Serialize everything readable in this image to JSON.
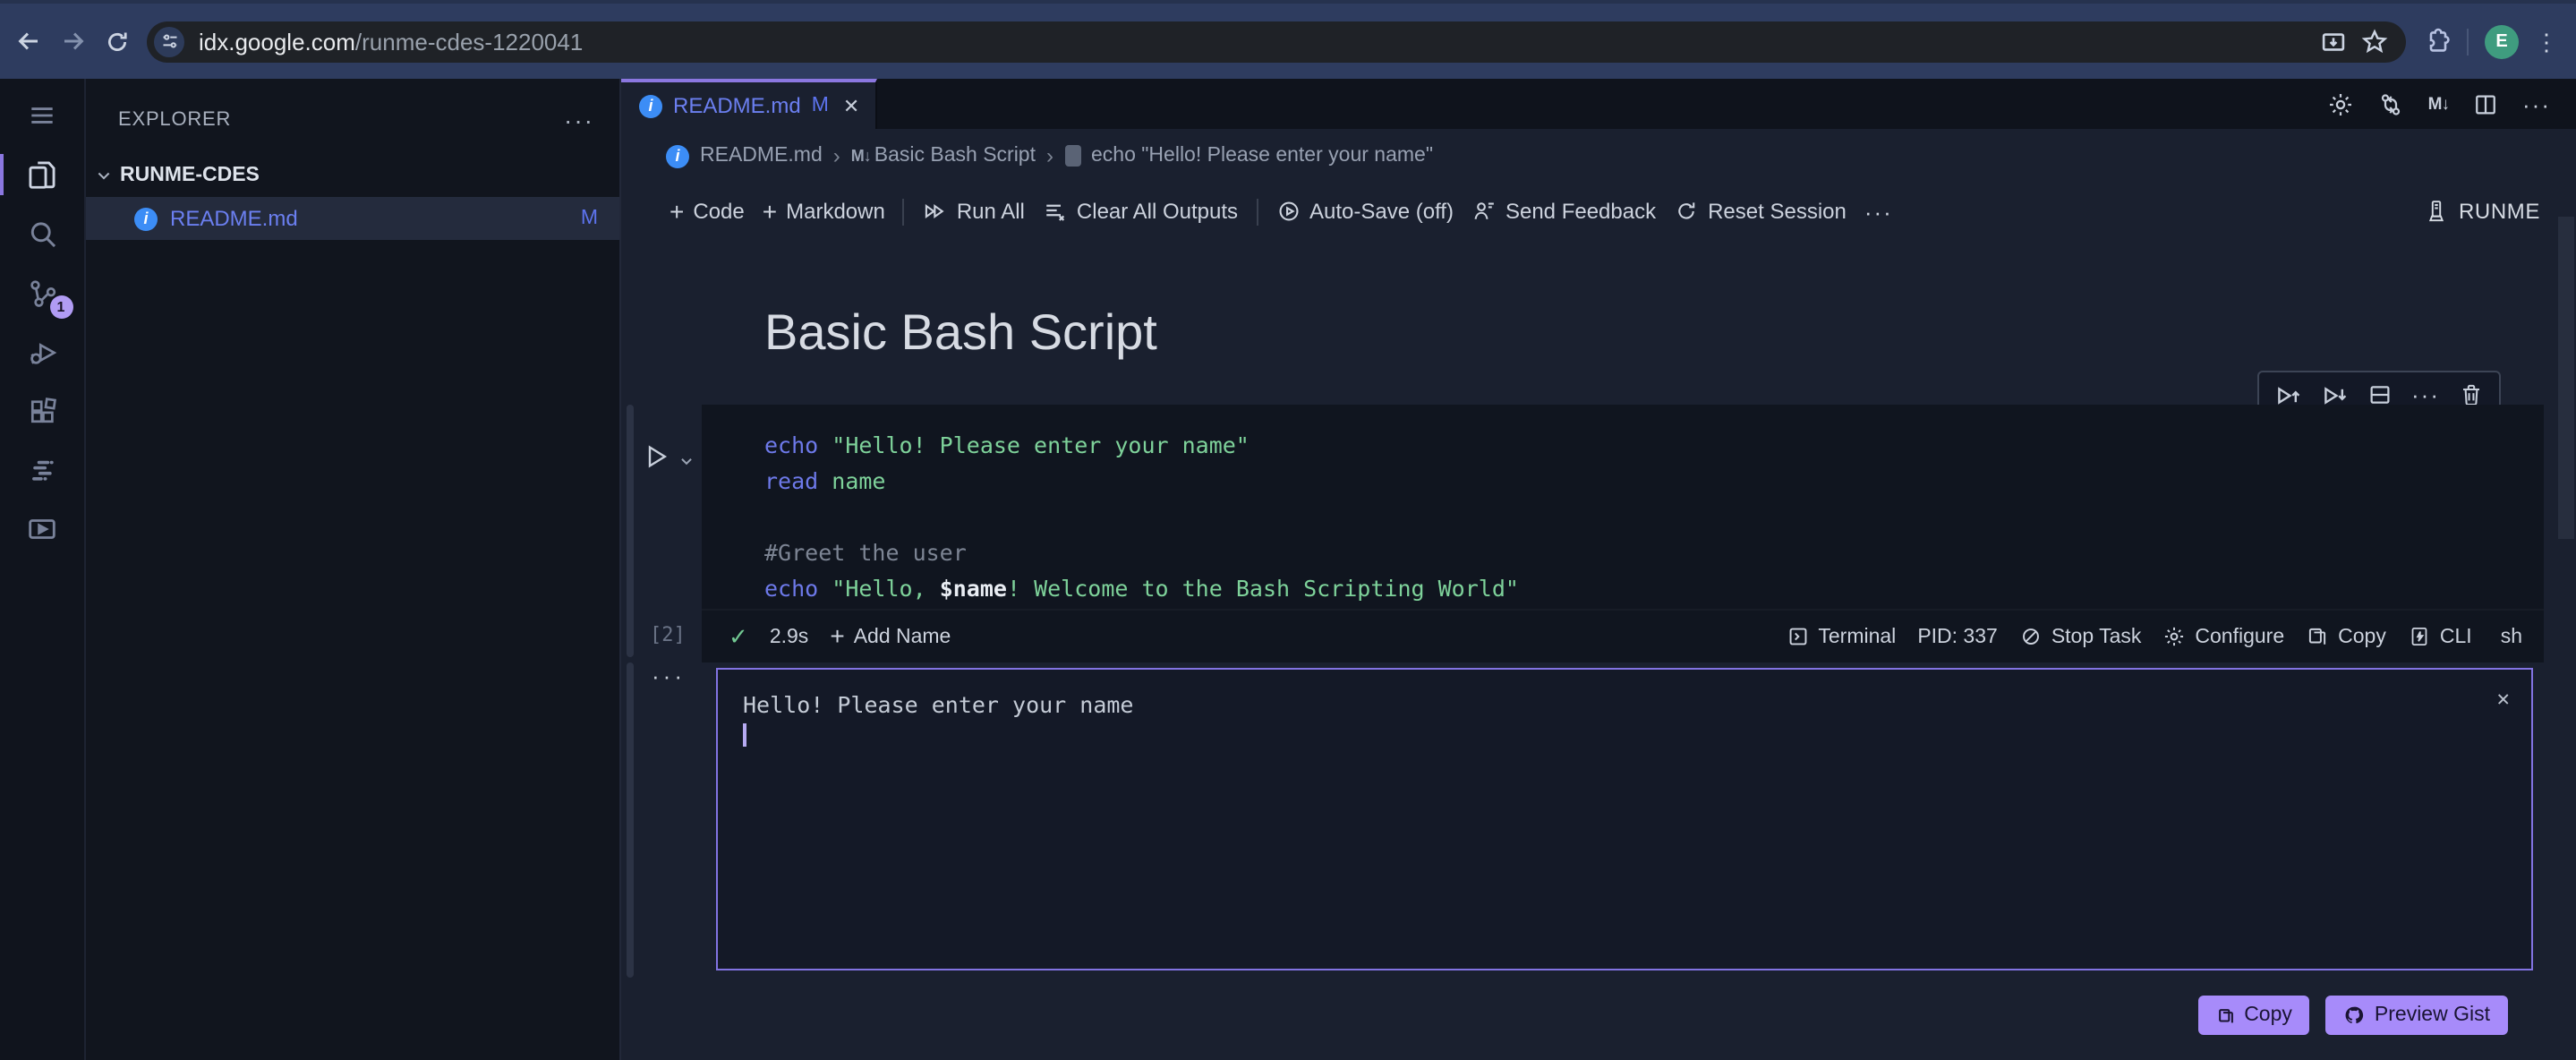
{
  "browser": {
    "url_host": "idx.google.com",
    "url_path": "/runme-cdes-1220041",
    "avatar_initial": "E"
  },
  "icons": {
    "kebab": "⋮",
    "more_h": "···",
    "close": "✕",
    "check": "✓",
    "plus": "+",
    "markdown_badge": "M↓",
    "crumb_sep": "›",
    "info": "i"
  },
  "sidebar": {
    "title": "EXPLORER",
    "folder": "RUNME-CDES",
    "file": {
      "name": "README.md",
      "badge": "M"
    }
  },
  "activity_bar": {
    "scm_badge": "1"
  },
  "tab": {
    "name": "README.md",
    "modified": "M"
  },
  "breadcrumb": {
    "file": "README.md",
    "section": "Basic Bash Script",
    "cell": "echo \"Hello! Please enter your name\""
  },
  "toolbar": {
    "code": "Code",
    "markdown": "Markdown",
    "run_all": "Run All",
    "clear_all": "Clear All Outputs",
    "autosave": "Auto-Save (off)",
    "feedback": "Send Feedback",
    "reset": "Reset Session",
    "brand": "RUNME"
  },
  "notebook": {
    "heading": "Basic Bash Script",
    "cell": {
      "exec_count": "[2]",
      "duration": "2.9s",
      "add_name": "Add Name",
      "status_right": {
        "terminal": "Terminal",
        "pid": "PID: 337",
        "stop": "Stop Task",
        "configure": "Configure",
        "copy": "Copy",
        "cli": "CLI",
        "lang": "sh"
      },
      "code": {
        "l1": {
          "kw": "echo",
          "str": " \"Hello! Please enter your name\""
        },
        "l2": {
          "kw": "read",
          "arg": " name"
        },
        "l3": {
          "cmt": "#Greet the user"
        },
        "l4": {
          "kw": "echo",
          "str1": " \"Hello, ",
          "var": "$name",
          "str2": "! Welcome to the Bash Scripting World\""
        }
      },
      "output": {
        "text": "Hello! Please enter your name"
      }
    },
    "gist_actions": {
      "copy": "Copy",
      "preview": "Preview Gist"
    }
  },
  "colors": {
    "accent_purple": "#8b77e0",
    "button_purple": "#a78bfa",
    "file_blue": "#6b7ff0",
    "info_blue": "#3c8df6",
    "string_green": "#7ed29a",
    "keyword_indigo": "#6d79e9",
    "check_green": "#72c892",
    "chrome_navy": "#2e3c5f",
    "avatar_green": "#3f9c7f"
  }
}
